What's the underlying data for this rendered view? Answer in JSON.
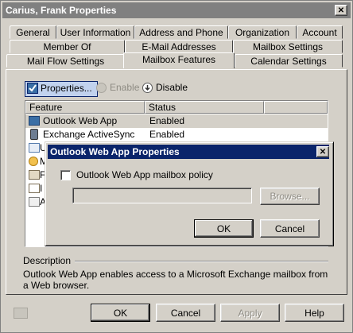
{
  "window": {
    "title": "Carius, Frank Properties",
    "close_glyph": "✕"
  },
  "tabs": {
    "row1": [
      "General",
      "User Information",
      "Address and Phone",
      "Organization",
      "Account"
    ],
    "row2": [
      "Member Of",
      "E-Mail Addresses",
      "Mailbox Settings"
    ],
    "row3": [
      "Mail Flow Settings",
      "Mailbox Features",
      "Calendar Settings"
    ],
    "active": "Mailbox Features"
  },
  "toolbar": {
    "properties_label": "Properties...",
    "enable_label": "Enable",
    "disable_label": "Disable"
  },
  "features_list": {
    "columns": [
      "Feature",
      "Status"
    ],
    "rows": [
      {
        "feature": "Outlook Web App",
        "status": "Enabled",
        "icon": "outlook-web-app-icon"
      },
      {
        "feature": "Exchange ActiveSync",
        "status": "Enabled",
        "icon": "activesync-icon"
      }
    ],
    "partial_letters": [
      "U",
      "M",
      "F",
      "I",
      "A"
    ]
  },
  "description": {
    "label": "Description",
    "text": "Outlook Web App enables access to a Microsoft Exchange mailbox from a Web browser."
  },
  "bottom_buttons": {
    "ok": "OK",
    "cancel": "Cancel",
    "apply": "Apply",
    "help": "Help"
  },
  "dialog": {
    "title": "Outlook Web App Properties",
    "close_glyph": "✕",
    "checkbox_label": "Outlook Web App mailbox policy",
    "checkbox_checked": false,
    "policy_value": "",
    "browse_label": "Browse...",
    "ok_label": "OK",
    "cancel_label": "Cancel"
  },
  "colors": {
    "face": "#d4d0c8",
    "inactive_title": "#808080",
    "active_title": "#0a246a",
    "selection": "#d4d0c8"
  }
}
